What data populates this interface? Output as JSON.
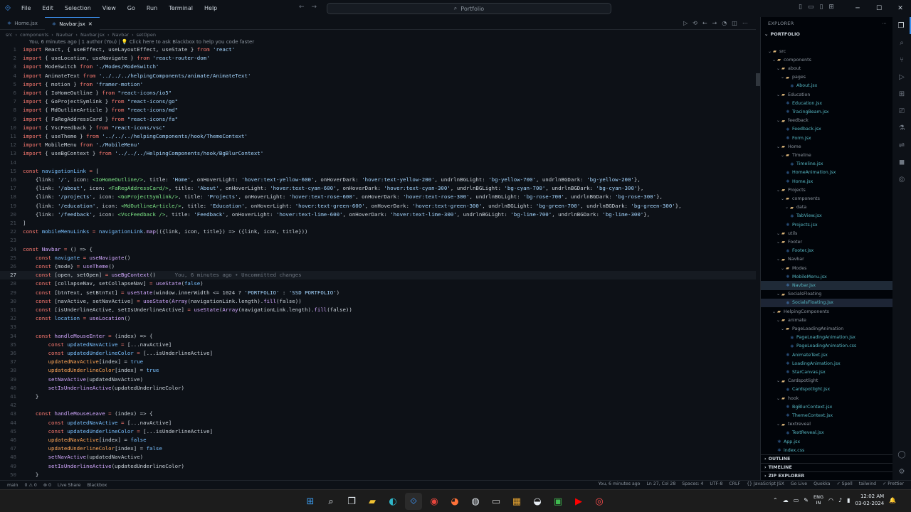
{
  "titlebar": {
    "menus": [
      "File",
      "Edit",
      "Selection",
      "View",
      "Go",
      "Run",
      "Terminal",
      "Help"
    ],
    "search_text": "Portfolio"
  },
  "tabs": [
    {
      "label": "Home.jsx",
      "active": false
    },
    {
      "label": "Navbar.jsx",
      "active": true
    }
  ],
  "breadcrumb": [
    "src",
    "components",
    "Navbar",
    "Navbar.jsx",
    "Navbar",
    "setOpen"
  ],
  "blame": "You, 6 minutes ago | 1 author (You) | 💡 Click here to ask Blackbox to help you code faster",
  "code_lines": [
    {
      "n": "1",
      "html": "<span class='kw'>import</span> <span class='tx'>React, { useEffect, useLayoutEffect, useState }</span> <span class='kw'>from</span> <span class='str'>'react'</span>"
    },
    {
      "n": "2",
      "html": "<span class='kw'>import</span> <span class='tx'>{ useLocation, useNavigate }</span> <span class='kw'>from</span> <span class='str'>'react-router-dom'</span>"
    },
    {
      "n": "3",
      "html": "<span class='kw'>import</span> <span class='tx'>ModeSwitch</span> <span class='kw'>from</span> <span class='str'>'./Modes/ModeSwitch'</span>"
    },
    {
      "n": "4",
      "html": "<span class='kw'>import</span> <span class='tx'>AnimateText</span> <span class='kw'>from</span> <span class='str'>'../../../helpingComponents/animate/AnimateText'</span>"
    },
    {
      "n": "5",
      "html": "<span class='kw'>import</span> <span class='tx'>{ motion }</span> <span class='kw'>from</span> <span class='str'>'framer-motion'</span>"
    },
    {
      "n": "6",
      "html": "<span class='kw'>import</span> <span class='tx'>{ IoHomeOutline }</span> <span class='kw'>from</span> <span class='str'>\"react-icons/io5\"</span>"
    },
    {
      "n": "7",
      "html": "<span class='kw'>import</span> <span class='tx'>{ GoProjectSymlink }</span> <span class='kw'>from</span> <span class='str'>\"react-icons/go\"</span>"
    },
    {
      "n": "8",
      "html": "<span class='kw'>import</span> <span class='tx'>{ MdOutlineArticle }</span> <span class='kw'>from</span> <span class='str'>\"react-icons/md\"</span>"
    },
    {
      "n": "9",
      "html": "<span class='kw'>import</span> <span class='tx'>{ FaRegAddressCard }</span> <span class='kw'>from</span> <span class='str'>\"react-icons/fa\"</span>"
    },
    {
      "n": "10",
      "html": "<span class='kw'>import</span> <span class='tx'>{ VscFeedback }</span> <span class='kw'>from</span> <span class='str'>\"react-icons/vsc\"</span>"
    },
    {
      "n": "11",
      "html": "<span class='kw'>import</span> <span class='tx'>{ useTheme }</span> <span class='kw'>from</span> <span class='str'>'../../../helpingComponents/hook/ThemeContext'</span>"
    },
    {
      "n": "12",
      "html": "<span class='kw'>import</span> <span class='tx'>MobileMenu</span> <span class='kw'>from</span> <span class='str'>'./MobileMenu'</span>"
    },
    {
      "n": "13",
      "html": "<span class='kw'>import</span> <span class='tx'>{ useBgContext }</span> <span class='kw'>from</span> <span class='str'>'../../../HelpingComponents/hook/BgBlurContext'</span>"
    },
    {
      "n": "14",
      "html": ""
    },
    {
      "n": "15",
      "html": "<span class='kw'>const</span> <span class='cn'>navigationLink</span> <span class='kw'>=</span> <span class='tx'>[</span>"
    },
    {
      "n": "16",
      "html": "    <span class='tx'>{link: </span><span class='str'>'/'</span><span class='tx'>, icon: </span><span class='tag'>&lt;IoHomeOutline/&gt;</span><span class='tx'>, title: </span><span class='str'>'Home'</span><span class='tx'>, onHoverLight: </span><span class='str'>'hover:text-yellow-600'</span><span class='tx'>, onHoverDark: </span><span class='str'>'hover:text-yellow-200'</span><span class='tx'>, undrlnBGLight: </span><span class='str'>'bg-yellow-700'</span><span class='tx'>, undrlnBGDark: </span><span class='str'>'bg-yellow-200'</span><span class='tx'>},</span>"
    },
    {
      "n": "17",
      "html": "    <span class='tx'>{link: </span><span class='str'>'/about'</span><span class='tx'>, icon: </span><span class='tag'>&lt;FaRegAddressCard/&gt;</span><span class='tx'>, title: </span><span class='str'>'About'</span><span class='tx'>, onHoverLight: </span><span class='str'>'hover:text-cyan-600'</span><span class='tx'>, onHoverDark: </span><span class='str'>'hover:text-cyan-300'</span><span class='tx'>, undrlnBGLight: </span><span class='str'>'bg-cyan-700'</span><span class='tx'>, undrlnBGDark: </span><span class='str'>'bg-cyan-300'</span><span class='tx'>},</span>"
    },
    {
      "n": "18",
      "html": "    <span class='tx'>{link: </span><span class='str'>'/projects'</span><span class='tx'>, icon: </span><span class='tag'>&lt;GoProjectSymlink/&gt;</span><span class='tx'>, title: </span><span class='str'>'Projects'</span><span class='tx'>, onHoverLight: </span><span class='str'>'hover:text-rose-600'</span><span class='tx'>, onHoverDark: </span><span class='str'>'hover:text-rose-300'</span><span class='tx'>, undrlnBGLight: </span><span class='str'>'bg-rose-700'</span><span class='tx'>, undrlnBGDark: </span><span class='str'>'bg-rose-300'</span><span class='tx'>},</span>"
    },
    {
      "n": "19",
      "html": "    <span class='tx'>{link: </span><span class='str'>'/education'</span><span class='tx'>, icon: </span><span class='tag'>&lt;MdOutlineArticle/&gt;</span><span class='tx'>, title: </span><span class='str'>'Education'</span><span class='tx'>, onHoverLight: </span><span class='str'>'hover:text-green-600'</span><span class='tx'>, onHoverDark: </span><span class='str'>'hover:text-green-300'</span><span class='tx'>, undrlnBGLight: </span><span class='str'>'bg-green-700'</span><span class='tx'>, undrlnBGDark: </span><span class='str'>'bg-green-300'</span><span class='tx'>},</span>"
    },
    {
      "n": "20",
      "html": "    <span class='tx'>{link: </span><span class='str'>'/feedback'</span><span class='tx'>, icon: </span><span class='tag'>&lt;VscFeedback /&gt;</span><span class='tx'>, title: </span><span class='str'>'Feedback'</span><span class='tx'>, onHoverLight: </span><span class='str'>'hover:text-lime-600'</span><span class='tx'>, onHoverDark: </span><span class='str'>'hover:text-lime-300'</span><span class='tx'>, undrlnBGLight: </span><span class='str'>'bg-lime-700'</span><span class='tx'>, undrlnBGDark: </span><span class='str'>'bg-lime-300'</span><span class='tx'>},</span>"
    },
    {
      "n": "21",
      "html": "<span class='tx'>]</span>"
    },
    {
      "n": "22",
      "html": "<span class='kw'>const</span> <span class='cn'>mobileMenuLinks</span> <span class='kw'>=</span> <span class='cn'>navigationLink</span><span class='tx'>.</span><span class='fn'>map</span><span class='tx'>(({link, icon, title}) =&gt; ({link, icon, title}))</span>"
    },
    {
      "n": "23",
      "html": ""
    },
    {
      "n": "24",
      "html": "<span class='kw'>const</span> <span class='fn'>Navbar</span> <span class='kw'>=</span> <span class='tx'>() =&gt; {</span>"
    },
    {
      "n": "25",
      "html": "    <span class='kw'>const</span> <span class='cn'>navigate</span> <span class='kw'>=</span> <span class='fn'>useNavigate</span><span class='tx'>()</span>"
    },
    {
      "n": "26",
      "html": "    <span class='kw'>const</span> <span class='tx'>{mode}</span> <span class='kw'>=</span> <span class='fn'>useTheme</span><span class='tx'>()</span>"
    },
    {
      "n": "27",
      "html": "    <span class='kw'>const</span> <span class='tx'>[open, setOpen]</span> <span class='kw'>=</span> <span class='fn'>useBgContext</span><span class='tx'>()</span>      <span class='com'>You, 6 minutes ago • Uncommitted changes</span>",
      "cur": true
    },
    {
      "n": "28",
      "html": "    <span class='kw'>const</span> <span class='tx'>[collapseNav, setCollapseNav]</span> <span class='kw'>=</span> <span class='fn'>useState</span><span class='tx'>(</span><span class='cn'>false</span><span class='tx'>)</span>"
    },
    {
      "n": "29",
      "html": "    <span class='kw'>const</span> <span class='tx'>[btnText, setBtnTxt]</span> <span class='kw'>=</span> <span class='fn'>useState</span><span class='tx'>(window.innerWidth &lt;= 1024 ? </span><span class='str'>'PORTFOLIO'</span><span class='tx'> : </span><span class='str'>'SSD PORTFOLIO'</span><span class='tx'>)</span>"
    },
    {
      "n": "30",
      "html": "    <span class='kw'>const</span> <span class='tx'>[navActive, setNavActive]</span> <span class='kw'>=</span> <span class='fn'>useState</span><span class='tx'>(</span><span class='fn'>Array</span><span class='tx'>(navigationLink.length).</span><span class='fn'>fill</span><span class='tx'>(false))</span>"
    },
    {
      "n": "31",
      "html": "    <span class='kw'>const</span> <span class='tx'>[isUnderlineActive, setIsUnderlineActive]</span> <span class='kw'>=</span> <span class='fn'>useState</span><span class='tx'>(</span><span class='fn'>Array</span><span class='tx'>(navigationLink.length).</span><span class='fn'>fill</span><span class='tx'>(false))</span>"
    },
    {
      "n": "32",
      "html": "    <span class='kw'>const</span> <span class='cn'>location</span> <span class='kw'>=</span> <span class='fn'>useLocation</span><span class='tx'>()</span>"
    },
    {
      "n": "33",
      "html": ""
    },
    {
      "n": "34",
      "html": "    <span class='kw'>const</span> <span class='fn'>handleMouseEnter</span> <span class='kw'>=</span> <span class='tx'>(index) =&gt; {</span>"
    },
    {
      "n": "35",
      "html": "        <span class='kw'>const</span> <span class='cn'>updatedNavActive</span> <span class='kw'>=</span> <span class='tx'>[...navActive]</span>"
    },
    {
      "n": "36",
      "html": "        <span class='kw'>const</span> <span class='cn'>updatedUnderlineColor</span> <span class='kw'>=</span> <span class='tx'>[...isUnderlineActive]</span>"
    },
    {
      "n": "37",
      "html": "        <span class='var'>updatedNavActive</span><span class='tx'>[index] = </span><span class='cn'>true</span>"
    },
    {
      "n": "38",
      "html": "        <span class='var'>updatedUnderlineColor</span><span class='tx'>[index] = </span><span class='cn'>true</span>"
    },
    {
      "n": "39",
      "html": "        <span class='fn'>setNavActive</span><span class='tx'>(updatedNavActive)</span>"
    },
    {
      "n": "40",
      "html": "        <span class='fn'>setIsUnderlineActive</span><span class='tx'>(updatedUnderlineColor)</span>"
    },
    {
      "n": "41",
      "html": "    <span class='tx'>}</span>"
    },
    {
      "n": "42",
      "html": ""
    },
    {
      "n": "43",
      "html": "    <span class='kw'>const</span> <span class='fn'>handleMouseLeave</span> <span class='kw'>=</span> <span class='tx'>(index) =&gt; {</span>"
    },
    {
      "n": "44",
      "html": "        <span class='kw'>const</span> <span class='cn'>updatedNavActive</span> <span class='kw'>=</span> <span class='tx'>[...navActive]</span>"
    },
    {
      "n": "45",
      "html": "        <span class='kw'>const</span> <span class='cn'>updatedUnderlineColor</span> <span class='kw'>=</span> <span class='tx'>[...isUnderlineActive]</span>"
    },
    {
      "n": "46",
      "html": "        <span class='var'>updatedNavActive</span><span class='tx'>[index] = </span><span class='cn'>false</span>"
    },
    {
      "n": "47",
      "html": "        <span class='var'>updatedUnderlineColor</span><span class='tx'>[index] = </span><span class='cn'>false</span>"
    },
    {
      "n": "48",
      "html": "        <span class='fn'>setNavActive</span><span class='tx'>(updatedNavActive)</span>"
    },
    {
      "n": "49",
      "html": "        <span class='fn'>setIsUnderlineActive</span><span class='tx'>(updatedUnderlineColor)</span>"
    },
    {
      "n": "50",
      "html": "    <span class='tx'>}</span>"
    }
  ],
  "explorer": {
    "title": "EXPLORER",
    "root": "PORTFOLIO",
    "items": [
      {
        "label": "src",
        "depth": 1,
        "type": "folder"
      },
      {
        "label": "components",
        "depth": 2,
        "type": "folder"
      },
      {
        "label": "about",
        "depth": 3,
        "type": "folder"
      },
      {
        "label": "pages",
        "depth": 4,
        "type": "folder"
      },
      {
        "label": "About.jsx",
        "depth": 5,
        "type": "file"
      },
      {
        "label": "Education",
        "depth": 3,
        "type": "folder"
      },
      {
        "label": "Education.jsx",
        "depth": 4,
        "type": "file"
      },
      {
        "label": "TracingBeam.jsx",
        "depth": 4,
        "type": "file"
      },
      {
        "label": "feedback",
        "depth": 3,
        "type": "folder"
      },
      {
        "label": "Feedback.jsx",
        "depth": 4,
        "type": "file"
      },
      {
        "label": "Form.jsx",
        "depth": 4,
        "type": "file"
      },
      {
        "label": "Home",
        "depth": 3,
        "type": "folder"
      },
      {
        "label": "Timeline",
        "depth": 4,
        "type": "folder"
      },
      {
        "label": "Timeline.jsx",
        "depth": 5,
        "type": "file"
      },
      {
        "label": "HomeAnimation.jsx",
        "depth": 4,
        "type": "file"
      },
      {
        "label": "Home.jsx",
        "depth": 4,
        "type": "file"
      },
      {
        "label": "Projects",
        "depth": 3,
        "type": "folder"
      },
      {
        "label": "components",
        "depth": 4,
        "type": "folder"
      },
      {
        "label": "data",
        "depth": 5,
        "type": "folder"
      },
      {
        "label": "TabView.jsx",
        "depth": 5,
        "type": "file"
      },
      {
        "label": "Projects.jsx",
        "depth": 4,
        "type": "file"
      },
      {
        "label": "utils",
        "depth": 3,
        "type": "folder"
      },
      {
        "label": "Footer",
        "depth": 3,
        "type": "folder"
      },
      {
        "label": "Footer.jsx",
        "depth": 4,
        "type": "file"
      },
      {
        "label": "Navbar",
        "depth": 3,
        "type": "folder"
      },
      {
        "label": "Modes",
        "depth": 4,
        "type": "folder"
      },
      {
        "label": "MobileMenu.jsx",
        "depth": 4,
        "type": "file"
      },
      {
        "label": "Navbar.jsx",
        "depth": 4,
        "type": "file",
        "selected": true
      },
      {
        "label": "SocialsFloating",
        "depth": 3,
        "type": "folder"
      },
      {
        "label": "SocialsFloating.jsx",
        "depth": 4,
        "type": "file",
        "hl": true
      },
      {
        "label": "HelpingComponents",
        "depth": 2,
        "type": "folder"
      },
      {
        "label": "animate",
        "depth": 3,
        "type": "folder"
      },
      {
        "label": "PageLoadingAnimation",
        "depth": 4,
        "type": "folder"
      },
      {
        "label": "PageLoadingAnimation.jsx",
        "depth": 5,
        "type": "file"
      },
      {
        "label": "PageLoadingAnimation.css",
        "depth": 5,
        "type": "file"
      },
      {
        "label": "AnimateText.jsx",
        "depth": 4,
        "type": "file"
      },
      {
        "label": "LoadingAnimation.jsx",
        "depth": 4,
        "type": "file"
      },
      {
        "label": "StarCanvas.jsx",
        "depth": 4,
        "type": "file"
      },
      {
        "label": "Cardspotlight",
        "depth": 3,
        "type": "folder"
      },
      {
        "label": "Cardspotlight.jsx",
        "depth": 4,
        "type": "file"
      },
      {
        "label": "hook",
        "depth": 3,
        "type": "folder"
      },
      {
        "label": "BgBlurContext.jsx",
        "depth": 4,
        "type": "file"
      },
      {
        "label": "ThemeContext.jsx",
        "depth": 4,
        "type": "file"
      },
      {
        "label": "textreveal",
        "depth": 3,
        "type": "folder"
      },
      {
        "label": "TextReveal.jsx",
        "depth": 4,
        "type": "file"
      },
      {
        "label": "App.jsx",
        "depth": 2,
        "type": "file"
      },
      {
        "label": "index.css",
        "depth": 2,
        "type": "file"
      }
    ],
    "sections": [
      "OUTLINE",
      "TIMELINE",
      "ZIP EXPLORER"
    ]
  },
  "statusbar": {
    "left": [
      "main",
      "0 ⚠ 0",
      "⊗ 0",
      "Live Share",
      "Blackbox"
    ],
    "right": [
      "You, 6 minutes ago",
      "Ln 27, Col 28",
      "Spaces: 4",
      "UTF-8",
      "CRLF",
      "{} JavaScript JSX",
      "Go Live",
      "Quokka",
      "✓ Spell",
      "tailwind",
      "✓ Prettier"
    ]
  },
  "taskbar": {
    "tray_lang_top": "ENG",
    "tray_lang_bottom": "IN",
    "time": "12:02 AM",
    "date": "03-02-2024"
  },
  "colors": {
    "accent": "#3b8eea",
    "background": "#0d1117",
    "keyword": "#ff7b72",
    "string": "#a5d6ff"
  }
}
